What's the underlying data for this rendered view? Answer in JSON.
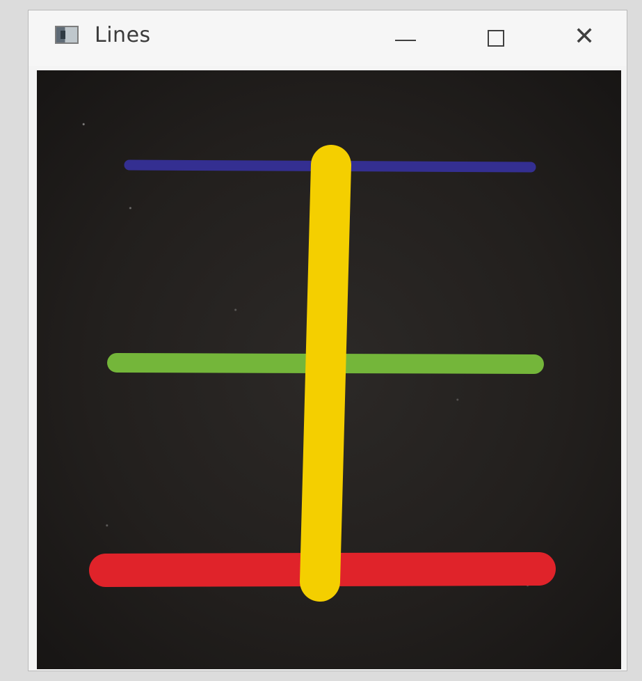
{
  "window": {
    "title": "Lines",
    "controls": {
      "minimize": "—",
      "close": "✕"
    }
  },
  "canvas": {
    "background_color": "#221f1d",
    "lines": [
      {
        "name": "blue-line",
        "color": "#342f91"
      },
      {
        "name": "green-line",
        "color": "#74b63a"
      },
      {
        "name": "red-line",
        "color": "#e0232a"
      },
      {
        "name": "yellow-line",
        "color": "#f4cf00"
      }
    ]
  },
  "icons": {
    "app": "window-app-icon",
    "minimize": "minimize-icon",
    "maximize": "maximize-icon",
    "close": "close-icon"
  }
}
